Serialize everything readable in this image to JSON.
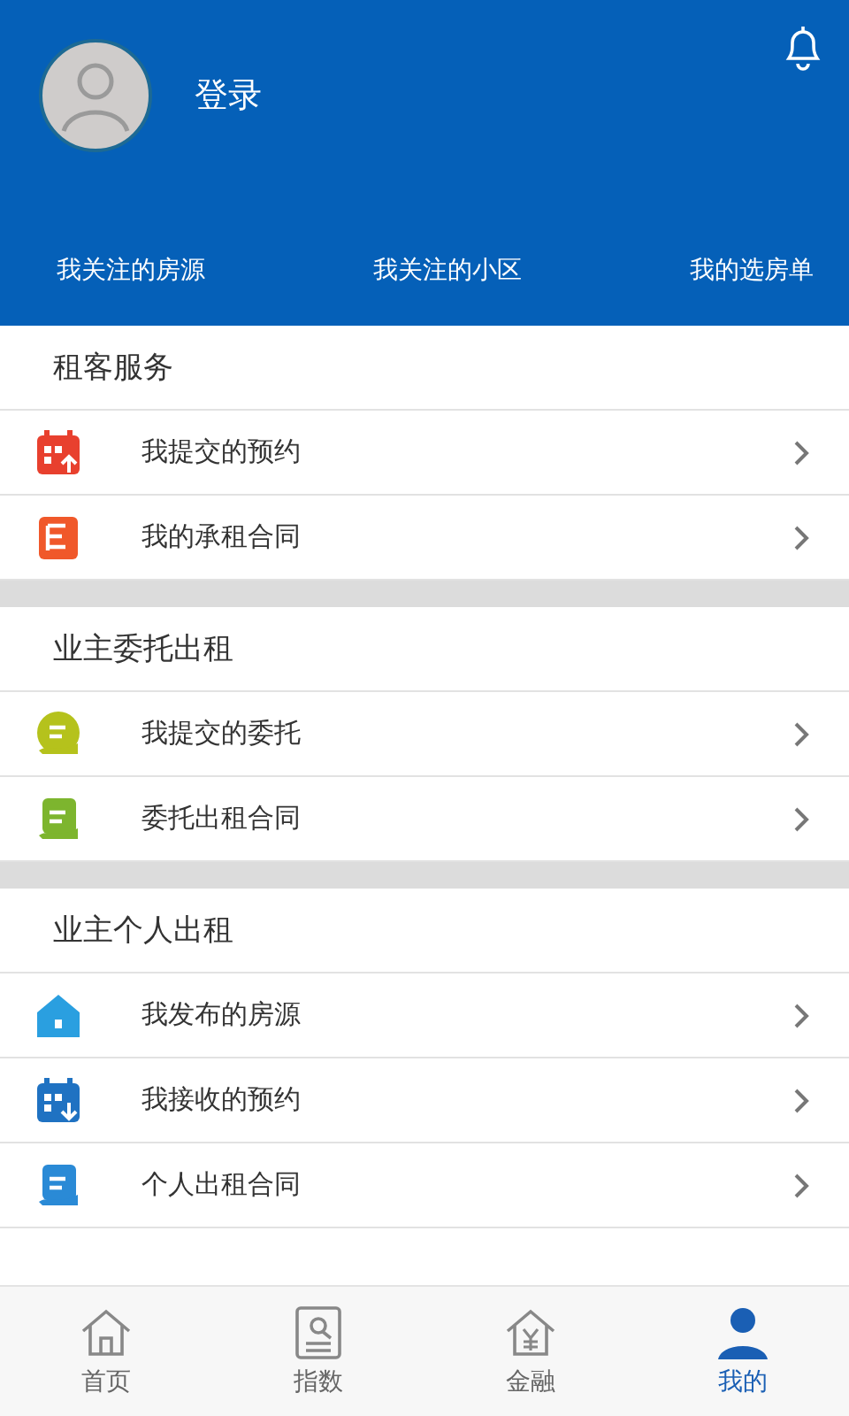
{
  "header": {
    "login": "登录",
    "links": [
      "我关注的房源",
      "我关注的小区",
      "我的选房单"
    ]
  },
  "sections": [
    {
      "title": "租客服务",
      "items": [
        {
          "label": "我提交的预约",
          "kind": "calendar-up",
          "color": "#e8402e"
        },
        {
          "label": "我的承租合同",
          "kind": "contract",
          "color": "#f0582a"
        }
      ]
    },
    {
      "title": "业主委托出租",
      "items": [
        {
          "label": "我提交的委托",
          "kind": "hand",
          "color": "#b5c21c"
        },
        {
          "label": "委托出租合同",
          "kind": "hand-doc",
          "color": "#7db52e"
        }
      ]
    },
    {
      "title": "业主个人出租",
      "items": [
        {
          "label": "我发布的房源",
          "kind": "house",
          "color": "#2a9fe0"
        },
        {
          "label": "我接收的预约",
          "kind": "calendar-down",
          "color": "#1f72c2"
        },
        {
          "label": "个人出租合同",
          "kind": "hand-doc",
          "color": "#2a8ad6"
        }
      ]
    }
  ],
  "nav": [
    {
      "label": "首页",
      "kind": "home",
      "selected": false
    },
    {
      "label": "指数",
      "kind": "index",
      "selected": false
    },
    {
      "label": "金融",
      "kind": "finance",
      "selected": false
    },
    {
      "label": "我的",
      "kind": "me",
      "selected": true
    }
  ]
}
